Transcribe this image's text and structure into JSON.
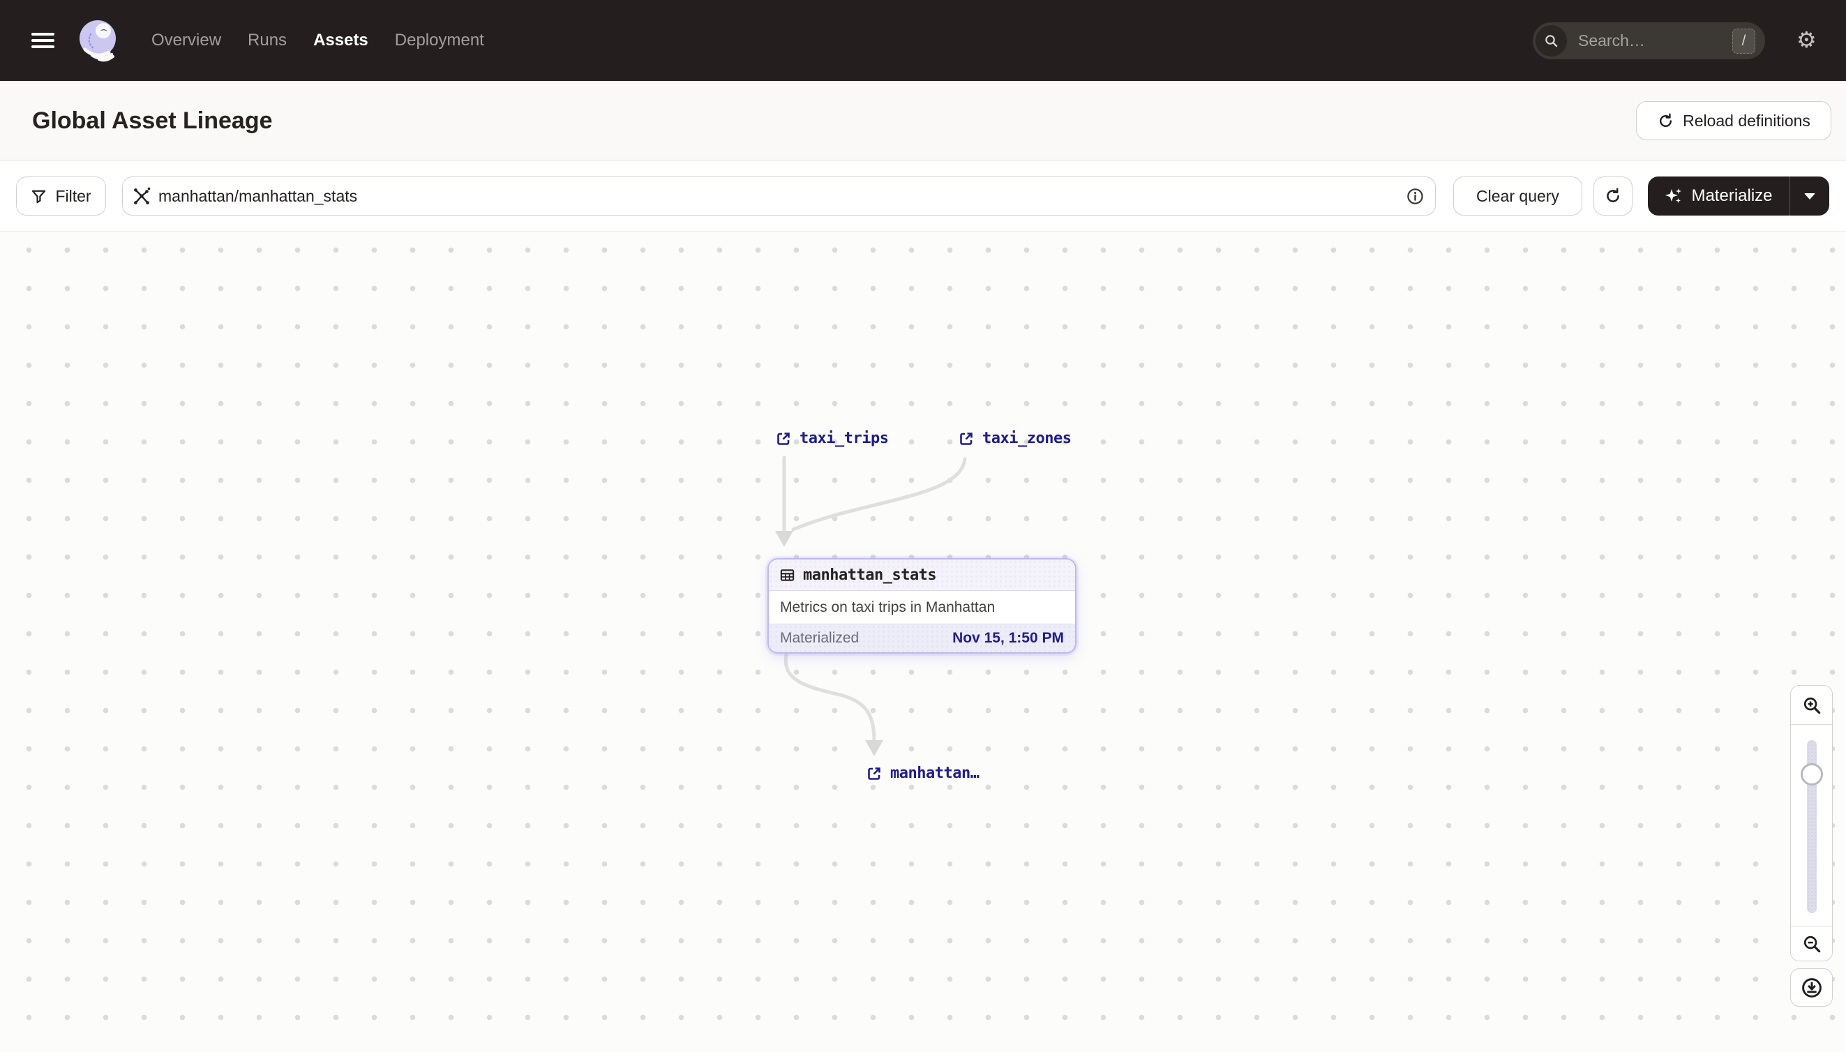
{
  "header": {
    "nav": [
      {
        "label": "Overview",
        "active": false
      },
      {
        "label": "Runs",
        "active": false
      },
      {
        "label": "Assets",
        "active": true
      },
      {
        "label": "Deployment",
        "active": false
      }
    ],
    "search_placeholder": "Search…",
    "search_shortcut": "/"
  },
  "page": {
    "title": "Global Asset Lineage",
    "reload_button": "Reload definitions"
  },
  "toolbar": {
    "filter_button": "Filter",
    "query_value": "manhattan/manhattan_stats",
    "clear_button": "Clear query",
    "materialize_button": "Materialize"
  },
  "graph": {
    "source_nodes": [
      {
        "label": "taxi_trips"
      },
      {
        "label": "taxi_zones"
      }
    ],
    "asset_card": {
      "name": "manhattan_stats",
      "description": "Metrics on taxi trips in Manhattan",
      "status_label": "Materialized",
      "materialized_at": "Nov 15, 1:50 PM"
    },
    "downstream_node": {
      "label": "manhattan…"
    }
  },
  "colors": {
    "header_bg": "#241F1E",
    "accent_navy": "#1F1D8C",
    "card_border": "#BEB8EE",
    "card_header_bg": "#F4F3FB",
    "card_footer_bg": "#EDEDF9",
    "edge_gray": "#DFDFDE",
    "canvas_dot": "#DBDBDA",
    "logo_lavender": "#CBC7F1"
  }
}
